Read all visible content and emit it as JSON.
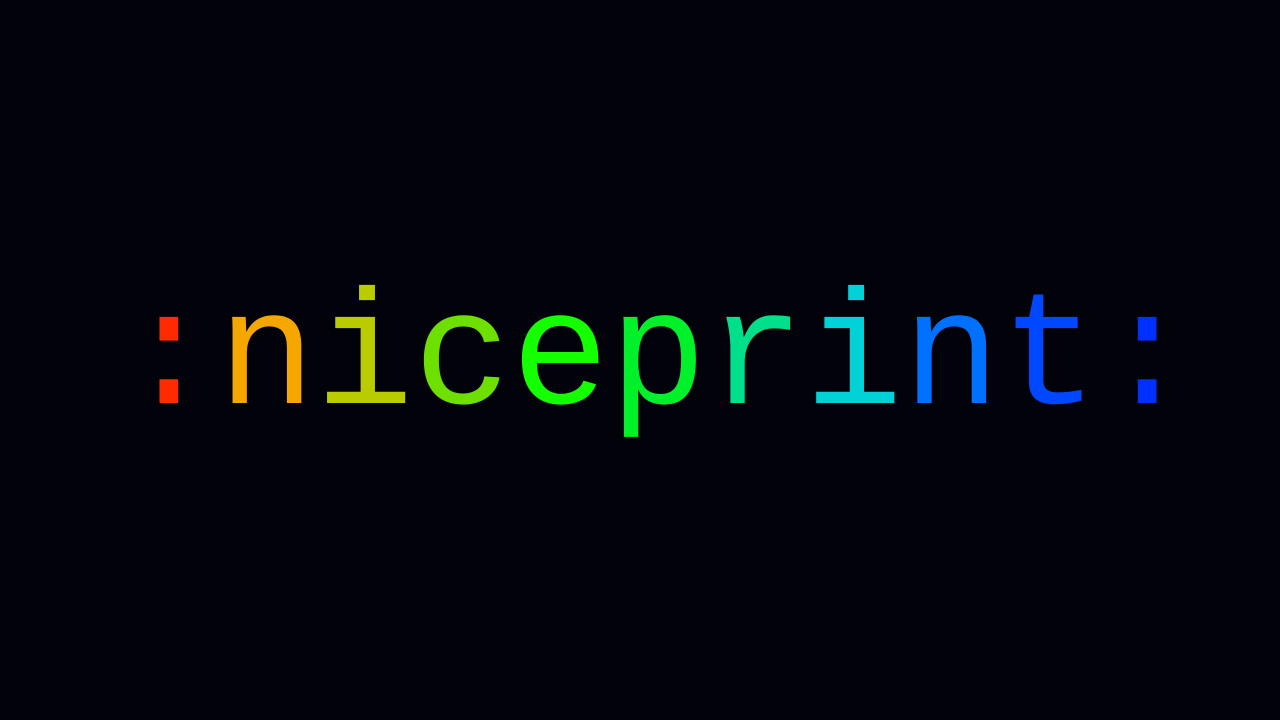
{
  "logo": {
    "text": ":niceprint:",
    "letters": [
      {
        "char": ":",
        "color": "#ff2a00"
      },
      {
        "char": "n",
        "color": "#f5a700"
      },
      {
        "char": "i",
        "color": "#b8cc00"
      },
      {
        "char": "c",
        "color": "#6ee000"
      },
      {
        "char": "e",
        "color": "#14ff00"
      },
      {
        "char": "p",
        "color": "#00f02a"
      },
      {
        "char": "r",
        "color": "#00e08a"
      },
      {
        "char": "i",
        "color": "#00d2d8"
      },
      {
        "char": "n",
        "color": "#0070ff"
      },
      {
        "char": "t",
        "color": "#0048ff"
      },
      {
        "char": ":",
        "color": "#0030ff"
      }
    ]
  },
  "background": "#02020a"
}
